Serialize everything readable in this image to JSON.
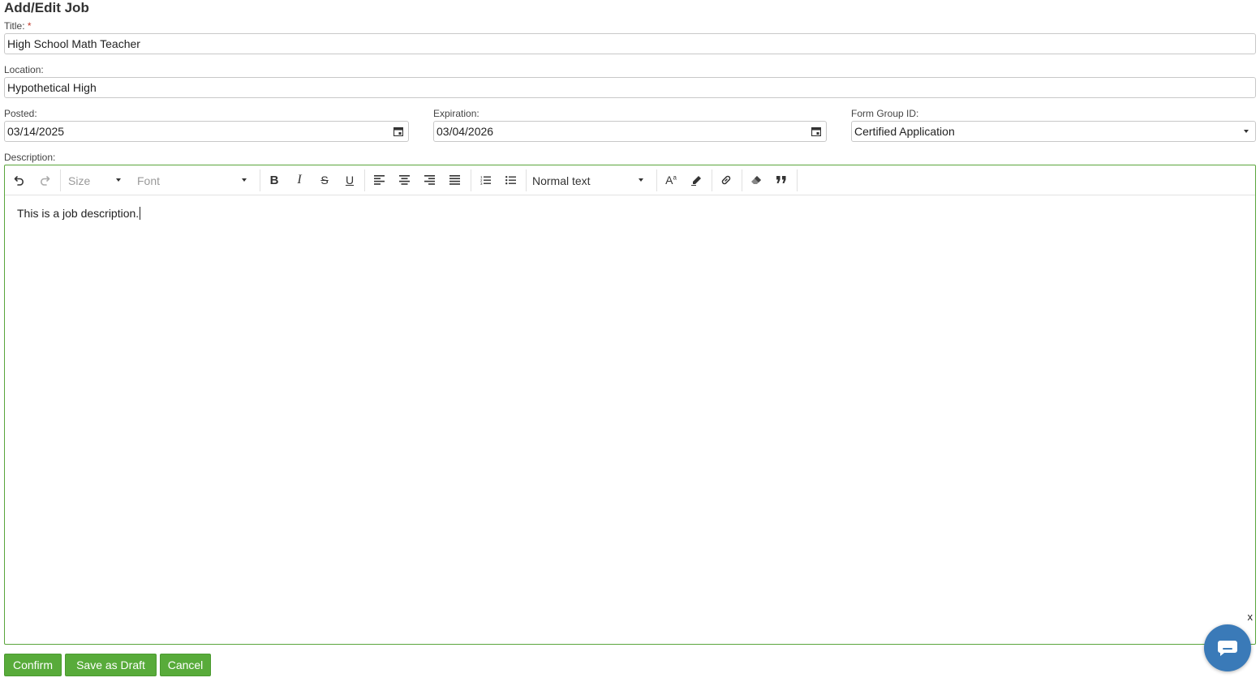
{
  "page": {
    "title": "Add/Edit Job"
  },
  "form": {
    "title_label": "Title:",
    "required_mark": "*",
    "title_value": "High School Math Teacher",
    "location_label": "Location:",
    "location_value": "Hypothetical High",
    "posted_label": "Posted:",
    "posted_value": "03/14/2025",
    "expiration_label": "Expiration:",
    "expiration_value": "03/04/2026",
    "form_group_label": "Form Group ID:",
    "form_group_value": "Certified Application",
    "description_label": "Description:"
  },
  "editor": {
    "size_placeholder": "Size",
    "font_placeholder": "Font",
    "block_format": "Normal text",
    "content": "This is a job description.",
    "close_label": "x"
  },
  "buttons": {
    "confirm": "Confirm",
    "save_draft": "Save as Draft",
    "cancel": "Cancel"
  },
  "colors": {
    "accent_green": "#58ab3a",
    "editor_border": "#5aa53c",
    "chat_blue": "#3a7ab8"
  },
  "icons": [
    "undo-icon",
    "redo-icon",
    "bold-icon",
    "italic-icon",
    "strikethrough-icon",
    "underline-icon",
    "align-left-icon",
    "align-center-icon",
    "align-right-icon",
    "align-justify-icon",
    "ordered-list-icon",
    "unordered-list-icon",
    "font-color-icon",
    "highlight-icon",
    "link-icon",
    "eraser-icon",
    "quote-icon",
    "calendar-icon",
    "chat-icon"
  ]
}
